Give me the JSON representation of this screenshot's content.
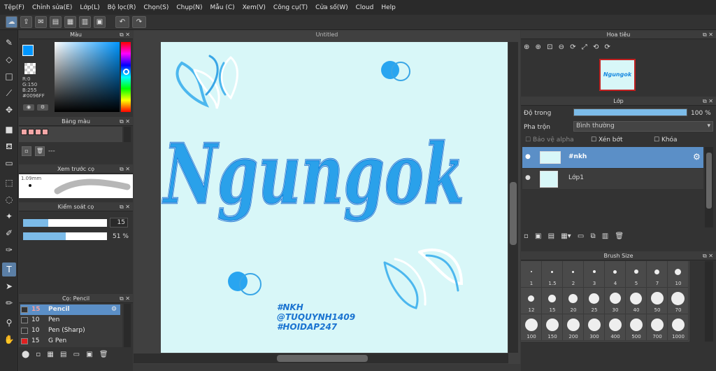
{
  "menu": [
    "Tệp(F)",
    "Chỉnh sửa(E)",
    "Lớp(L)",
    "Bộ lọc(R)",
    "Chọn(S)",
    "Chụp(N)",
    "Mẫu (C)",
    "Xem(V)",
    "Công cụ(T)",
    "Cửa số(W)",
    "Cloud",
    "Help"
  ],
  "color_panel": {
    "title": "Màu",
    "r": "R:0",
    "g": "G:150",
    "b": "B:255",
    "hex": "#0096FF",
    "main_color": "#0096FF"
  },
  "palette_panel": {
    "title": "Bảng màu",
    "dash": "---",
    "swatches": [
      "#f4a7a7",
      "#f4a7a7",
      "#f4a7a7",
      "#f4a7a7"
    ]
  },
  "preview_panel": {
    "title": "Xem trước cọ",
    "size": "1.09mm"
  },
  "control_panel": {
    "title": "Kiểm soát cọ",
    "size_value": "15",
    "opacity_value": "51",
    "percent": "%"
  },
  "brush_panel": {
    "title": "Cọ: Pencil",
    "brushes": [
      {
        "size": "15",
        "name": "Pencil",
        "color": "#333333",
        "selected": true
      },
      {
        "size": "10",
        "name": "Pen",
        "color": "#333333",
        "selected": false
      },
      {
        "size": "10",
        "name": "Pen (Sharp)",
        "color": "#333333",
        "selected": false
      },
      {
        "size": "15",
        "name": "G Pen",
        "color": "#e02020",
        "selected": false
      }
    ]
  },
  "canvas": {
    "title": "Untitled",
    "big_text": "Ngungok",
    "tag1": "#NKH",
    "tag2": "@TUQUYNH1409",
    "tag3": "#HOIDAP247",
    "bg": "#d8f7f8"
  },
  "nav_panel": {
    "title": "Hoa tiêu",
    "thumb_text": "Ngungok"
  },
  "layer_panel": {
    "title": "Lớp",
    "opacity_label": "Độ trong",
    "opacity_value": "100",
    "percent": "%",
    "blend_label": "Pha trộn",
    "blend_value": "Bình thường",
    "protect_alpha": "Bảo vệ alpha",
    "clipping": "Xén bớt",
    "lock": "Khóa",
    "layers": [
      {
        "name": "#nkh",
        "selected": true
      },
      {
        "name": "Lớp1",
        "selected": false
      }
    ]
  },
  "brush_size_panel": {
    "title": "Brush Size",
    "sizes": [
      "1",
      "1.5",
      "2",
      "3",
      "4",
      "5",
      "7",
      "10",
      "12",
      "15",
      "20",
      "25",
      "30",
      "40",
      "50",
      "70",
      "100",
      "150",
      "200",
      "300",
      "400",
      "500",
      "700",
      "1000"
    ]
  }
}
